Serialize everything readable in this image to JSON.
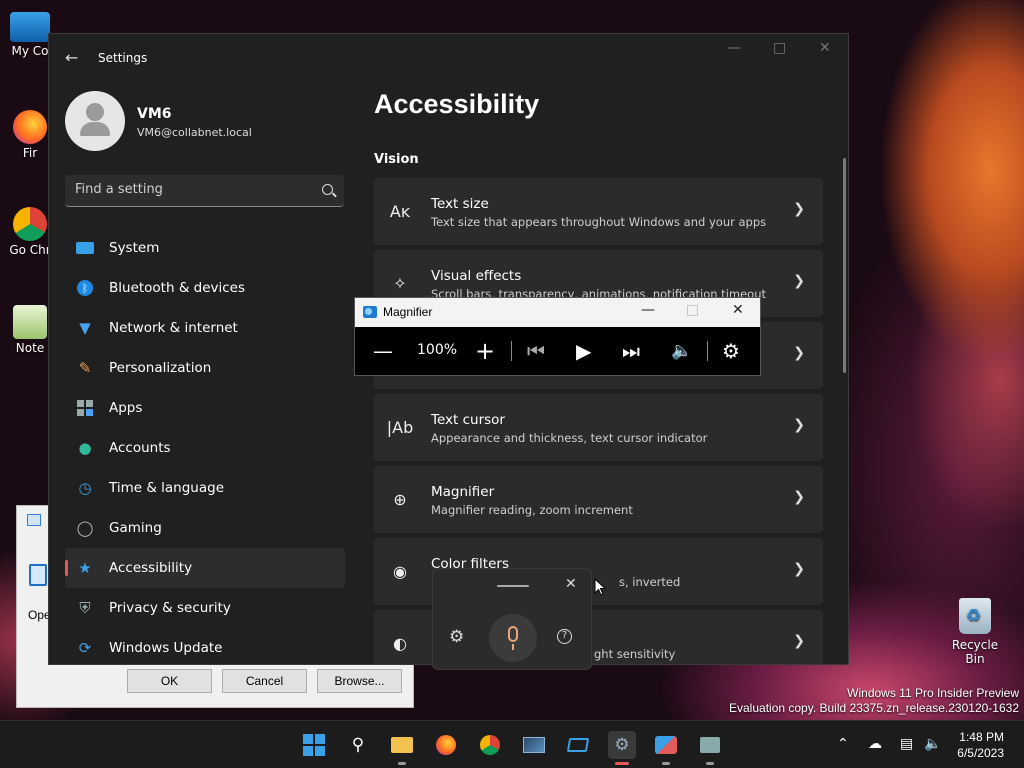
{
  "desktop": {
    "icons": [
      {
        "label": "My Co",
        "name": "my-computer"
      },
      {
        "label": "Fir",
        "name": "firefox"
      },
      {
        "label": "Go Chr",
        "name": "google-chrome"
      },
      {
        "label": "Note",
        "name": "notepad"
      }
    ],
    "recycle_bin": "Recycle Bin",
    "watermark": {
      "line1": "Windows 11 Pro Insider Preview",
      "line2": "Evaluation copy. Build 23375.zn_release.230120-1632"
    }
  },
  "back_dialog": {
    "open_label": "Ope",
    "ok": "OK",
    "cancel": "Cancel",
    "browse": "Browse..."
  },
  "settings": {
    "title": "Settings",
    "user": {
      "name": "VM6",
      "email": "VM6@collabnet.local"
    },
    "search_placeholder": "Find a setting",
    "nav": [
      {
        "label": "System",
        "icon": "system-icon"
      },
      {
        "label": "Bluetooth & devices",
        "icon": "bluetooth-icon"
      },
      {
        "label": "Network & internet",
        "icon": "wifi-icon"
      },
      {
        "label": "Personalization",
        "icon": "brush-icon"
      },
      {
        "label": "Apps",
        "icon": "apps-icon"
      },
      {
        "label": "Accounts",
        "icon": "person-icon"
      },
      {
        "label": "Time & language",
        "icon": "globe-clock-icon"
      },
      {
        "label": "Gaming",
        "icon": "gamepad-icon"
      },
      {
        "label": "Accessibility",
        "icon": "accessibility-icon",
        "active": true
      },
      {
        "label": "Privacy & security",
        "icon": "shield-icon"
      },
      {
        "label": "Windows Update",
        "icon": "update-icon"
      }
    ],
    "page_title": "Accessibility",
    "section": "Vision",
    "cards": [
      {
        "title": "Text size",
        "subtitle": "Text size that appears throughout Windows and your apps",
        "icon": "text-size-icon"
      },
      {
        "title": "Visual effects",
        "subtitle": "Scroll bars, transparency, animations, notification timeout",
        "icon": "sparkle-icon"
      },
      {
        "title": "",
        "subtitle": "",
        "icon": ""
      },
      {
        "title": "Text cursor",
        "subtitle": "Appearance and thickness, text cursor indicator",
        "icon": "text-cursor-icon"
      },
      {
        "title": "Magnifier",
        "subtitle": "Magnifier reading, zoom increment",
        "icon": "zoom-icon"
      },
      {
        "title": "Color filters",
        "subtitle": "s, inverted",
        "icon": "palette-icon"
      },
      {
        "title": "",
        "subtitle": "ght sensitivity",
        "icon": "contrast-icon"
      }
    ]
  },
  "magnifier": {
    "title": "Magnifier",
    "zoom": "100%"
  },
  "taskbar": {
    "time": "1:48 PM",
    "date": "6/5/2023"
  }
}
